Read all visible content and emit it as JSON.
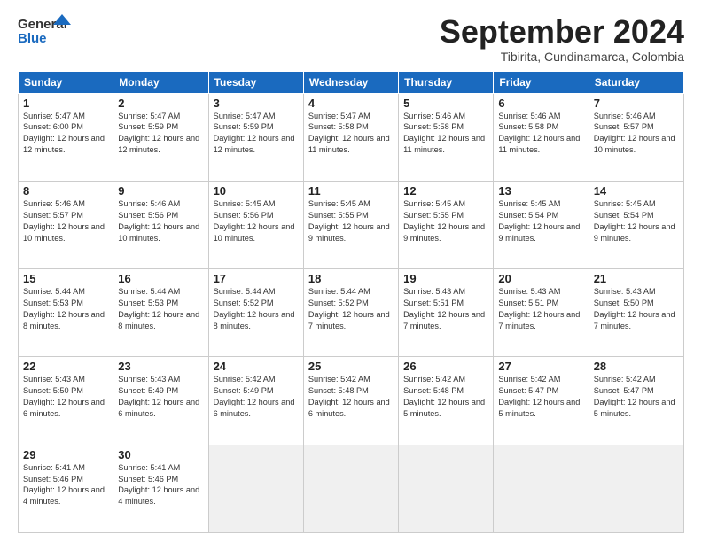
{
  "header": {
    "logo_line1": "General",
    "logo_line2": "Blue",
    "month_title": "September 2024",
    "subtitle": "Tibirita, Cundinamarca, Colombia"
  },
  "weekdays": [
    "Sunday",
    "Monday",
    "Tuesday",
    "Wednesday",
    "Thursday",
    "Friday",
    "Saturday"
  ],
  "weeks": [
    [
      {
        "day": "1",
        "sunrise": "5:47 AM",
        "sunset": "6:00 PM",
        "daylight": "12 hours and 12 minutes."
      },
      {
        "day": "2",
        "sunrise": "5:47 AM",
        "sunset": "5:59 PM",
        "daylight": "12 hours and 12 minutes."
      },
      {
        "day": "3",
        "sunrise": "5:47 AM",
        "sunset": "5:59 PM",
        "daylight": "12 hours and 12 minutes."
      },
      {
        "day": "4",
        "sunrise": "5:47 AM",
        "sunset": "5:58 PM",
        "daylight": "12 hours and 11 minutes."
      },
      {
        "day": "5",
        "sunrise": "5:46 AM",
        "sunset": "5:58 PM",
        "daylight": "12 hours and 11 minutes."
      },
      {
        "day": "6",
        "sunrise": "5:46 AM",
        "sunset": "5:58 PM",
        "daylight": "12 hours and 11 minutes."
      },
      {
        "day": "7",
        "sunrise": "5:46 AM",
        "sunset": "5:57 PM",
        "daylight": "12 hours and 10 minutes."
      }
    ],
    [
      {
        "day": "8",
        "sunrise": "5:46 AM",
        "sunset": "5:57 PM",
        "daylight": "12 hours and 10 minutes."
      },
      {
        "day": "9",
        "sunrise": "5:46 AM",
        "sunset": "5:56 PM",
        "daylight": "12 hours and 10 minutes."
      },
      {
        "day": "10",
        "sunrise": "5:45 AM",
        "sunset": "5:56 PM",
        "daylight": "12 hours and 10 minutes."
      },
      {
        "day": "11",
        "sunrise": "5:45 AM",
        "sunset": "5:55 PM",
        "daylight": "12 hours and 9 minutes."
      },
      {
        "day": "12",
        "sunrise": "5:45 AM",
        "sunset": "5:55 PM",
        "daylight": "12 hours and 9 minutes."
      },
      {
        "day": "13",
        "sunrise": "5:45 AM",
        "sunset": "5:54 PM",
        "daylight": "12 hours and 9 minutes."
      },
      {
        "day": "14",
        "sunrise": "5:45 AM",
        "sunset": "5:54 PM",
        "daylight": "12 hours and 9 minutes."
      }
    ],
    [
      {
        "day": "15",
        "sunrise": "5:44 AM",
        "sunset": "5:53 PM",
        "daylight": "12 hours and 8 minutes."
      },
      {
        "day": "16",
        "sunrise": "5:44 AM",
        "sunset": "5:53 PM",
        "daylight": "12 hours and 8 minutes."
      },
      {
        "day": "17",
        "sunrise": "5:44 AM",
        "sunset": "5:52 PM",
        "daylight": "12 hours and 8 minutes."
      },
      {
        "day": "18",
        "sunrise": "5:44 AM",
        "sunset": "5:52 PM",
        "daylight": "12 hours and 7 minutes."
      },
      {
        "day": "19",
        "sunrise": "5:43 AM",
        "sunset": "5:51 PM",
        "daylight": "12 hours and 7 minutes."
      },
      {
        "day": "20",
        "sunrise": "5:43 AM",
        "sunset": "5:51 PM",
        "daylight": "12 hours and 7 minutes."
      },
      {
        "day": "21",
        "sunrise": "5:43 AM",
        "sunset": "5:50 PM",
        "daylight": "12 hours and 7 minutes."
      }
    ],
    [
      {
        "day": "22",
        "sunrise": "5:43 AM",
        "sunset": "5:50 PM",
        "daylight": "12 hours and 6 minutes."
      },
      {
        "day": "23",
        "sunrise": "5:43 AM",
        "sunset": "5:49 PM",
        "daylight": "12 hours and 6 minutes."
      },
      {
        "day": "24",
        "sunrise": "5:42 AM",
        "sunset": "5:49 PM",
        "daylight": "12 hours and 6 minutes."
      },
      {
        "day": "25",
        "sunrise": "5:42 AM",
        "sunset": "5:48 PM",
        "daylight": "12 hours and 6 minutes."
      },
      {
        "day": "26",
        "sunrise": "5:42 AM",
        "sunset": "5:48 PM",
        "daylight": "12 hours and 5 minutes."
      },
      {
        "day": "27",
        "sunrise": "5:42 AM",
        "sunset": "5:47 PM",
        "daylight": "12 hours and 5 minutes."
      },
      {
        "day": "28",
        "sunrise": "5:42 AM",
        "sunset": "5:47 PM",
        "daylight": "12 hours and 5 minutes."
      }
    ],
    [
      {
        "day": "29",
        "sunrise": "5:41 AM",
        "sunset": "5:46 PM",
        "daylight": "12 hours and 4 minutes."
      },
      {
        "day": "30",
        "sunrise": "5:41 AM",
        "sunset": "5:46 PM",
        "daylight": "12 hours and 4 minutes."
      },
      null,
      null,
      null,
      null,
      null
    ]
  ]
}
